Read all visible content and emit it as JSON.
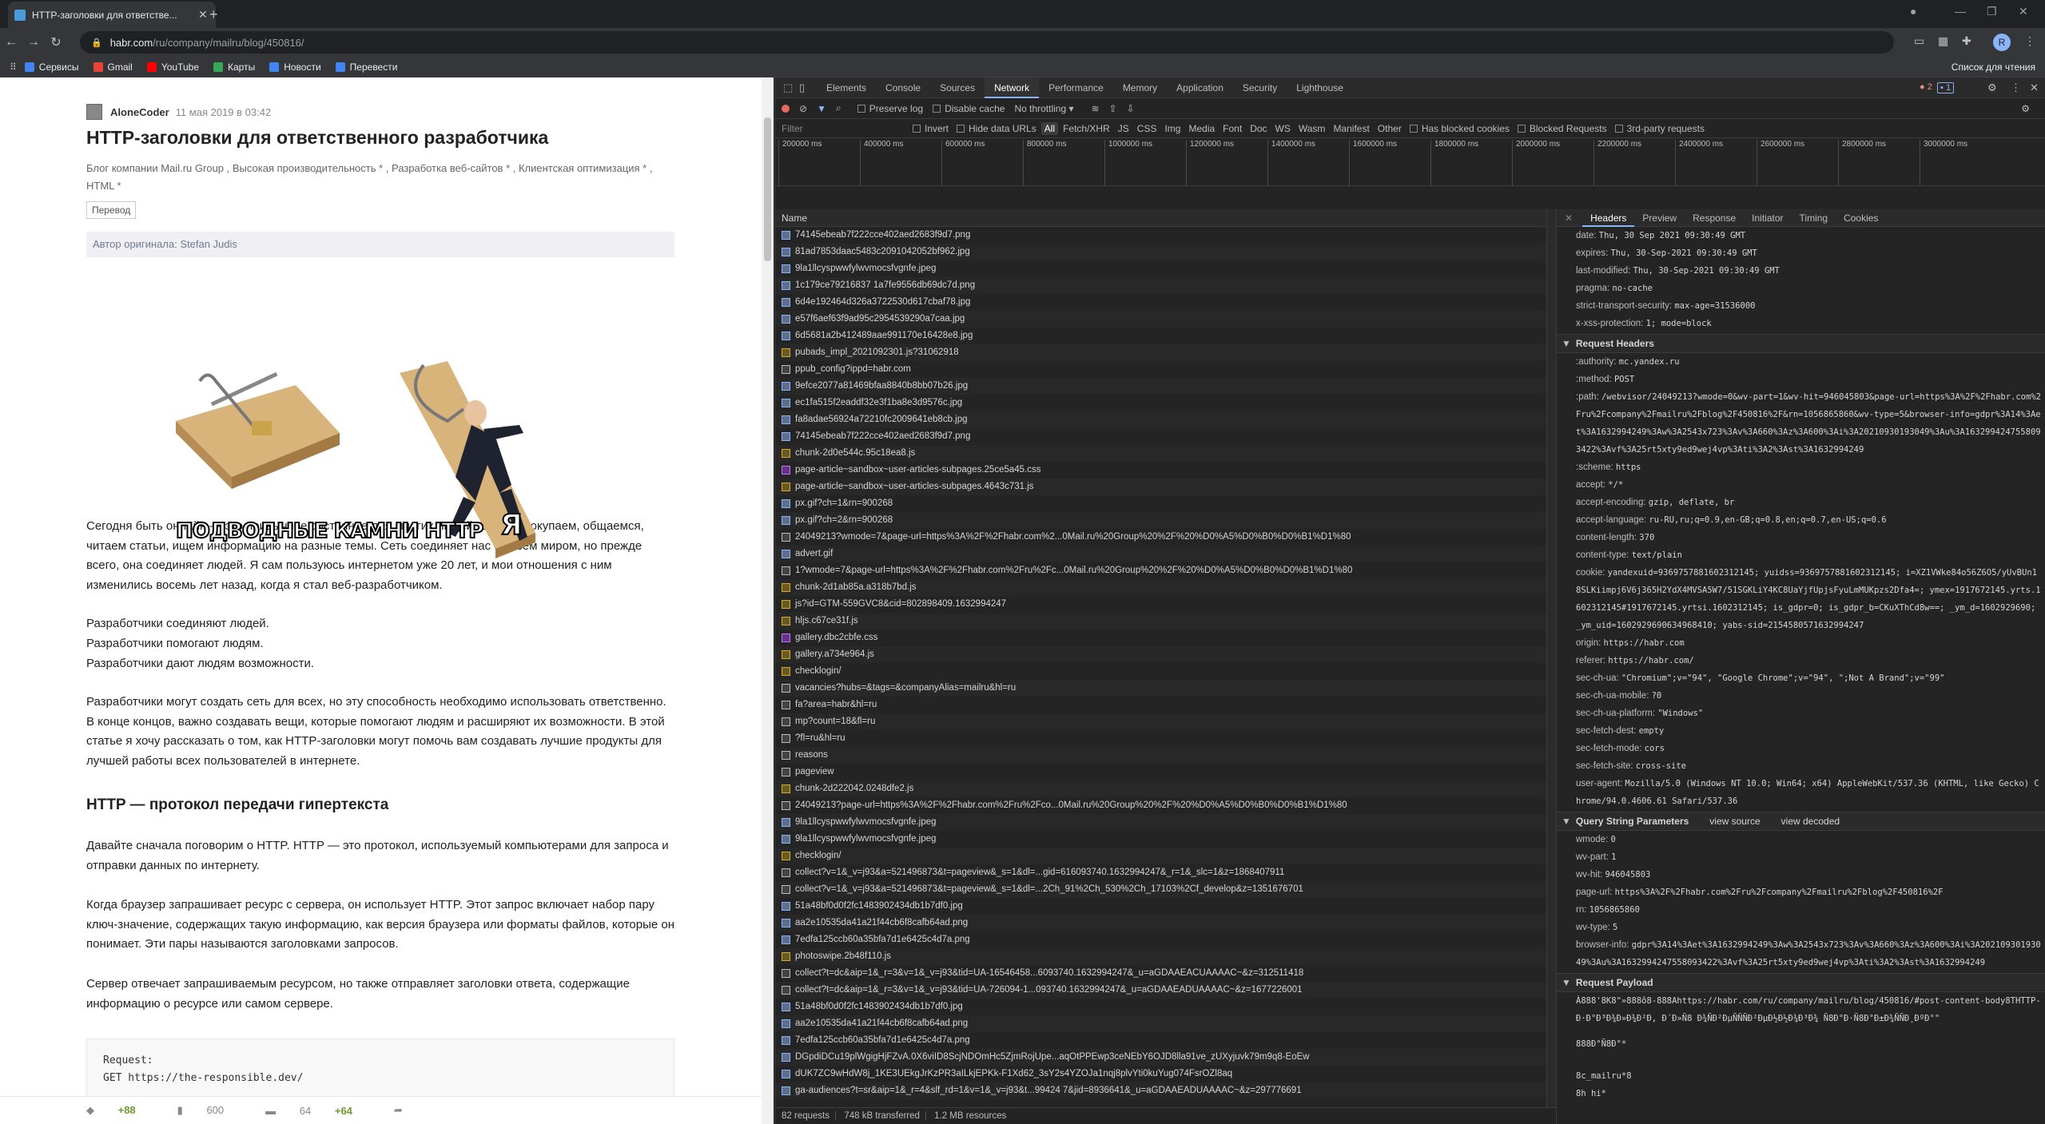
{
  "browser": {
    "tab_title": "HTTP-заголовки для ответстве...",
    "url_host": "habr.com",
    "url_path": "/ru/company/mailru/blog/450816/",
    "profile_initial": "R",
    "bookmarks": [
      {
        "label": "Сервисы",
        "color": "#4285f4"
      },
      {
        "label": "Gmail",
        "color": "#ea4335"
      },
      {
        "label": "YouTube",
        "color": "#ff0000"
      },
      {
        "label": "Карты",
        "color": "#34a853"
      },
      {
        "label": "Новости",
        "color": "#4285f4"
      },
      {
        "label": "Перевести",
        "color": "#4285f4"
      }
    ],
    "reading_list": "Список для чтения"
  },
  "article": {
    "author": "AloneCoder",
    "date": "11 мая 2019 в 03:42",
    "title": "HTTP-заголовки для ответственного разработчика",
    "hubs": "Блог компании Mail.ru Group , Высокая производительность * , Разработка веб-сайтов * , Клиентская оптимизация * , HTML *",
    "badge": "Перевод",
    "original_label": "Автор оригинала:",
    "original_author": "Stefan Judis",
    "picture_caption_left": "ПОДВОДНЫЕ КАМНИ HTTP",
    "picture_caption_right": "Я",
    "p1": "Сегодня быть онлайн — это привычное состояние для многих людей. Все мы покупаем, общаемся, читаем статьи, ищем информацию на разные темы. Сеть соединяет нас со всем миром, но прежде всего, она соединяет людей. Я сам пользуюсь интернетом уже 20 лет, и мои отношения с ним изменились восемь лет назад, когда я стал веб-разработчиком.",
    "p2a": "Разработчики соединяют людей.",
    "p2b": "Разработчики помогают людям.",
    "p2c": "Разработчики дают людям возможности.",
    "p3": "Разработчики могут создать сеть для всех, но эту способность необходимо использовать ответственно. В конце концов, важно создавать вещи, которые помогают людям и расширяют их возможности. В этой статье я хочу рассказать о том, как HTTP-заголовки могут помочь вам создавать лучшие продукты для лучшей работы всех пользователей в интернете.",
    "h2": "HTTP — протокол передачи гипертекста",
    "p4": "Давайте сначала поговорим о HTTP. HTTP — это протокол, используемый компьютерами для запроса и отправки данных по интернету.",
    "p5": "Когда браузер запрашивает ресурс с сервера, он использует HTTP. Этот запрос включает набор пару ключ-значение, содержащих такую информацию, как версия браузера или форматы файлов, которые он понимает. Эти пары называются заголовками запросов.",
    "p6": "Сервер отвечает запрашиваемым ресурсом, но также отправляет заголовки ответа, содержащие информацию о ресурсе или самом сервере.",
    "code_line1": "Request:",
    "code_line2": "GET https://the-responsible.dev/",
    "footer_rating": "+88",
    "footer_bookmarks": "600",
    "footer_comments": "64",
    "footer_new_comments": "+64"
  },
  "devtools": {
    "tabs": [
      "Elements",
      "Console",
      "Sources",
      "Network",
      "Performance",
      "Memory",
      "Application",
      "Security",
      "Lighthouse"
    ],
    "active_tab": "Network",
    "errors": "2",
    "messages": "1",
    "preserve_log": "Preserve log",
    "disable_cache": "Disable cache",
    "throttling": "No throttling",
    "filter_placeholder": "Filter",
    "invert": "Invert",
    "hide_data_urls": "Hide data URLs",
    "types": [
      "All",
      "Fetch/XHR",
      "JS",
      "CSS",
      "Img",
      "Media",
      "Font",
      "Doc",
      "WS",
      "Wasm",
      "Manifest",
      "Other"
    ],
    "blocked_cookies": "Has blocked cookies",
    "blocked_requests": "Blocked Requests",
    "third_party": "3rd-party requests",
    "timeline": [
      "200000 ms",
      "400000 ms",
      "600000 ms",
      "800000 ms",
      "1000000 ms",
      "1200000 ms",
      "1400000 ms",
      "1600000 ms",
      "1800000 ms",
      "2000000 ms",
      "2200000 ms",
      "2400000 ms",
      "2600000 ms",
      "2800000 ms",
      "3000000 ms"
    ],
    "name_header": "Name",
    "requests": [
      {
        "name": "74145ebeab7f222cce402aed2683f9d7.png",
        "type": "img"
      },
      {
        "name": "81ad7853daac5483c2091042052bf962.jpg",
        "type": "img"
      },
      {
        "name": "9la1llcyspwwfylwvmocsfvgnfe.jpeg",
        "type": "img"
      },
      {
        "name": "1c179ce79216837 1a7fe9556db69dc7d.png",
        "type": "img"
      },
      {
        "name": "6d4e192464d326a3722530d617cbaf78.jpg",
        "type": "img"
      },
      {
        "name": "e57f6aef63f9ad95c2954539290a7caa.jpg",
        "type": "img"
      },
      {
        "name": "6d5681a2b412489aae991170e16428e8.jpg",
        "type": "img"
      },
      {
        "name": "pubads_impl_2021092301.js?31062918",
        "type": "js"
      },
      {
        "name": "ppub_config?ippd=habr.com",
        "type": "xhr"
      },
      {
        "name": "9efce2077a81469bfaa8840b8bb07b26.jpg",
        "type": "img"
      },
      {
        "name": "ec1fa515f2eaddf32e3f1ba8e3d9576c.jpg",
        "type": "img"
      },
      {
        "name": "fa8adae56924a72210fc2009641eb8cb.jpg",
        "type": "img"
      },
      {
        "name": "74145ebeab7f222cce402aed2683f9d7.png",
        "type": "img"
      },
      {
        "name": "chunk-2d0e544c.95c18ea8.js",
        "type": "js"
      },
      {
        "name": "page-article~sandbox~user-articles-subpages.25ce5a45.css",
        "type": "css"
      },
      {
        "name": "page-article~sandbox~user-articles-subpages.4643c731.js",
        "type": "js"
      },
      {
        "name": "px.gif?ch=1&rn=900268",
        "type": "img"
      },
      {
        "name": "px.gif?ch=2&rn=900268",
        "type": "img"
      },
      {
        "name": "24049213?wmode=7&page-url=https%3A%2F%2Fhabr.com%2...0Mail.ru%20Group%20%2F%20%D0%A5%D0%B0%D0%B1%D1%80",
        "type": "xhr"
      },
      {
        "name": "advert.gif",
        "type": "img"
      },
      {
        "name": "1?wmode=7&page-url=https%3A%2F%2Fhabr.com%2Fru%2Fc...0Mail.ru%20Group%20%2F%20%D0%A5%D0%B0%D0%B1%D1%80",
        "type": "xhr"
      },
      {
        "name": "chunk-2d1ab85a.a318b7bd.js",
        "type": "js"
      },
      {
        "name": "js?id=GTM-559GVC8&cid=802898409.1632994247",
        "type": "js"
      },
      {
        "name": "hljs.c67ce31f.js",
        "type": "js"
      },
      {
        "name": "gallery.dbc2cbfe.css",
        "type": "css"
      },
      {
        "name": "gallery.a734e964.js",
        "type": "js"
      },
      {
        "name": "checklogin/",
        "type": "js"
      },
      {
        "name": "vacancies?hubs=&tags=&companyAlias=mailru&hl=ru",
        "type": "xhr"
      },
      {
        "name": "fa?area=habr&hl=ru",
        "type": "xhr"
      },
      {
        "name": "mp?count=18&fl=ru",
        "type": "xhr"
      },
      {
        "name": "?fl=ru&hl=ru",
        "type": "xhr"
      },
      {
        "name": "reasons",
        "type": "xhr"
      },
      {
        "name": "pageview",
        "type": "xhr"
      },
      {
        "name": "chunk-2d222042.0248dfe2.js",
        "type": "js"
      },
      {
        "name": "24049213?page-url=https%3A%2F%2Fhabr.com%2Fru%2Fco...0Mail.ru%20Group%20%2F%20%D0%A5%D0%B0%D0%B1%D1%80",
        "type": "xhr"
      },
      {
        "name": "9la1llcyspwwfylwvmocsfvgnfe.jpeg",
        "type": "img"
      },
      {
        "name": "9la1llcyspwwfylwvmocsfvgnfe.jpeg",
        "type": "img"
      },
      {
        "name": "checklogin/",
        "type": "js"
      },
      {
        "name": "collect?v=1&_v=j93&a=521496873&t=pageview&_s=1&dl=...gid=616093740.1632994247&_r=1&_slc=1&z=1868407911",
        "type": "xhr"
      },
      {
        "name": "collect?v=1&_v=j93&a=521496873&t=pageview&_s=1&dl=...2Ch_91%2Ch_530%2Ch_17103%2Cf_develop&z=1351676701",
        "type": "xhr"
      },
      {
        "name": "51a48bf0d0f2fc1483902434db1b7df0.jpg",
        "type": "img"
      },
      {
        "name": "aa2e10535da41a21f44cb6f8cafb64ad.png",
        "type": "img"
      },
      {
        "name": "7edfa125ccb60a35bfa7d1e6425c4d7a.png",
        "type": "img"
      },
      {
        "name": "photoswipe.2b48f110.js",
        "type": "js"
      },
      {
        "name": "collect?t=dc&aip=1&_r=3&v=1&_v=j93&tid=UA-16546458...6093740.1632994247&_u=aGDAAEACUAAAAC~&z=312511418",
        "type": "xhr"
      },
      {
        "name": "collect?t=dc&aip=1&_r=3&v=1&_v=j93&tid=UA-726094-1...093740.1632994247&_u=aGDAAEADUAAAAC~&z=1677226001",
        "type": "xhr"
      },
      {
        "name": "51a48bf0d0f2fc1483902434db1b7df0.jpg",
        "type": "img"
      },
      {
        "name": "aa2e10535da41a21f44cb6f8cafb64ad.png",
        "type": "img"
      },
      {
        "name": "7edfa125ccb60a35bfa7d1e6425c4d7a.png",
        "type": "img"
      },
      {
        "name": "DGpdiDCu19plWgigHjFZvA.0X6viID8ScjNDOmHc5ZjmRojUpe...aqOtPPEwp3ceNEbY6OJD8lla91ve_zUXyjuvk79m9q8-EoEw",
        "type": "img"
      },
      {
        "name": "dUK7ZC9wHdW8j_1KE3UEkgJrKzPR3aILkjEPKk-F1Xd62_3sY2s4YZOJa1nqj8plvYti0kuYug074FsrOZl8aq",
        "type": "img"
      },
      {
        "name": "ga-audiences?t=sr&aip=1&_r=4&slf_rd=1&v=1&_v=j93&t...99424 7&jid=8936641&_u=aGDAAEADUAAAAC~&z=297776691",
        "type": "img"
      }
    ],
    "status_requests": "82 requests",
    "status_transferred": "748 kB transferred",
    "status_resources": "1.2 MB resources",
    "detail_tabs": [
      "Headers",
      "Preview",
      "Response",
      "Initiator",
      "Timing",
      "Cookies"
    ],
    "response_headers": [
      {
        "k": "date:",
        "v": "Thu, 30 Sep 2021 09:30:49 GMT"
      },
      {
        "k": "expires:",
        "v": "Thu, 30-Sep-2021 09:30:49 GMT"
      },
      {
        "k": "last-modified:",
        "v": "Thu, 30-Sep-2021 09:30:49 GMT"
      },
      {
        "k": "pragma:",
        "v": "no-cache"
      },
      {
        "k": "strict-transport-security:",
        "v": "max-age=31536000"
      },
      {
        "k": "x-xss-protection:",
        "v": "1; mode=block"
      }
    ],
    "request_headers_title": "Request Headers",
    "request_headers": [
      {
        "k": ":authority:",
        "v": "mc.yandex.ru"
      },
      {
        "k": ":method:",
        "v": "POST"
      },
      {
        "k": ":path:",
        "v": "/webvisor/24049213?wmode=0&wv-part=1&wv-hit=946045803&page-url=https%3A%2F%2Fhabr.com%2Fru%2Fcompany%2Fmailru%2Fblog%2F450816%2F&rn=1056865860&wv-type=5&browser-info=gdpr%3A14%3Aet%3A1632994249%3Aw%3A2543x723%3Av%3A660%3Az%3A600%3Ai%3A20210930193049%3Au%3A1632994247558093422%3Avf%3A25rt5xty9ed9wej4vp%3Ati%3A2%3Ast%3A1632994249"
      },
      {
        "k": ":scheme:",
        "v": "https"
      },
      {
        "k": "accept:",
        "v": "*/*"
      },
      {
        "k": "accept-encoding:",
        "v": "gzip, deflate, br"
      },
      {
        "k": "accept-language:",
        "v": "ru-RU,ru;q=0.9,en-GB;q=0.8,en;q=0.7,en-US;q=0.6"
      },
      {
        "k": "content-length:",
        "v": "370"
      },
      {
        "k": "content-type:",
        "v": "text/plain"
      },
      {
        "k": "cookie:",
        "v": "yandexuid=9369757881602312145; yuidss=9369757881602312145; i=XZ1VWke84o56Z6O5/yUvBUn18SLKiimpj6V6j365H2YdX4MVSA5W7/51SGKLiY4KC8UaYjfUpjsFyuLmMUKpzs2Dfa4=; ymex=1917672145.yrts.1602312145#1917672145.yrtsi.1602312145; is_gdpr=0; is_gdpr_b=CKuXThCd8w==; _ym_d=1602929690; _ym_uid=1602929690634968410; yabs-sid=2154580571632994247"
      },
      {
        "k": "origin:",
        "v": "https://habr.com"
      },
      {
        "k": "referer:",
        "v": "https://habr.com/"
      },
      {
        "k": "sec-ch-ua:",
        "v": "\"Chromium\";v=\"94\", \"Google Chrome\";v=\"94\", \";Not A Brand\";v=\"99\""
      },
      {
        "k": "sec-ch-ua-mobile:",
        "v": "?0"
      },
      {
        "k": "sec-ch-ua-platform:",
        "v": "\"Windows\""
      },
      {
        "k": "sec-fetch-dest:",
        "v": "empty"
      },
      {
        "k": "sec-fetch-mode:",
        "v": "cors"
      },
      {
        "k": "sec-fetch-site:",
        "v": "cross-site"
      },
      {
        "k": "user-agent:",
        "v": "Mozilla/5.0 (Windows NT 10.0; Win64; x64) AppleWebKit/537.36 (KHTML, like Gecko) Chrome/94.0.4606.61 Safari/537.36"
      }
    ],
    "qs_title": "Query String Parameters",
    "view_source": "view source",
    "view_decoded": "view decoded",
    "query_params": [
      {
        "k": "wmode:",
        "v": "0"
      },
      {
        "k": "wv-part:",
        "v": "1"
      },
      {
        "k": "wv-hit:",
        "v": "946045803"
      },
      {
        "k": "page-url:",
        "v": "https%3A%2F%2Fhabr.com%2Fru%2Fcompany%2Fmailru%2Fblog%2F450816%2F"
      },
      {
        "k": "rn:",
        "v": "1056865860"
      },
      {
        "k": "wv-type:",
        "v": "5"
      },
      {
        "k": "browser-info:",
        "v": "gdpr%3A14%3Aet%3A1632994249%3Aw%3A2543x723%3Av%3A660%3Az%3A600%3Ai%3A20210930193049%3Au%3A1632994247558093422%3Avf%3A25rt5xty9ed9wej4vp%3Ati%3A2%3Ast%3A1632994249"
      }
    ],
    "payload_title": "Request Payload",
    "payload_line1": "À888'8К8\"»888ô8-888Ahttps://habr.com/ru/company/mailru/blog/450816/#post-content-body8THTTP-Ð·Ð°Ð³Ð¾Ð»Ð¾Ð²Ð, Ð´Ð»Ñ8 Ð¾ÑÐ²ÐµÑÑÑÐ²ÐµÐ½Ð½Ð¾Ð³Ð¾ Ñ8Ð°Ð·Ñ8Ð°Ð±Ð¾ÑÑÐ¸ÐºÐ°\"",
    "payload_line2": "888Ð°Ñ8Ð°*",
    "payload_line3": "8c_mailru*8",
    "payload_line4": "8h hi*"
  }
}
